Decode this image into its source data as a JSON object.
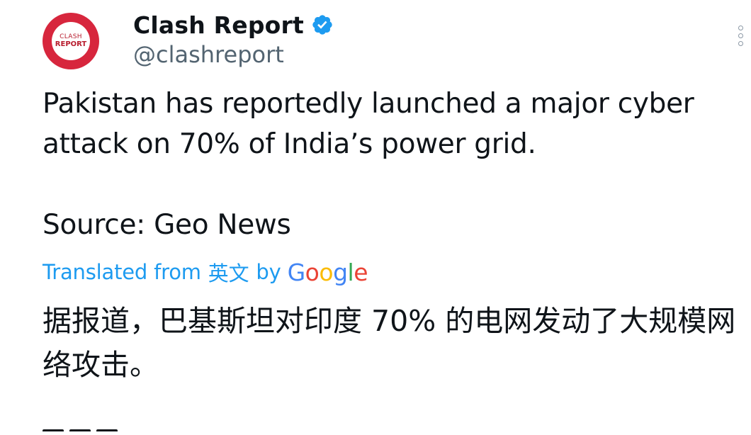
{
  "author": {
    "display_name": "Clash Report",
    "handle": "@clashreport",
    "verified": true,
    "avatar": {
      "line1": "CLASH",
      "line2": "REPORT",
      "color": "#d7263d"
    }
  },
  "tweet": {
    "text": "Pakistan has reportedly launched a major cyber attack on 70% of India’s power grid.",
    "source": "Source: Geo News"
  },
  "translation": {
    "prefix": "Translated from",
    "language": "英文",
    "by": "by",
    "provider": "Google",
    "text": "据报道，巴基斯坦对印度 70% 的电网发动了大规模网络攻击。"
  },
  "colors": {
    "link": "#1d9bf0",
    "verified": "#1d9bf0",
    "secondary": "#536471",
    "text": "#0f1419"
  },
  "icons": {
    "verified": "verified-badge-icon",
    "more": "more-vertical-icon"
  }
}
